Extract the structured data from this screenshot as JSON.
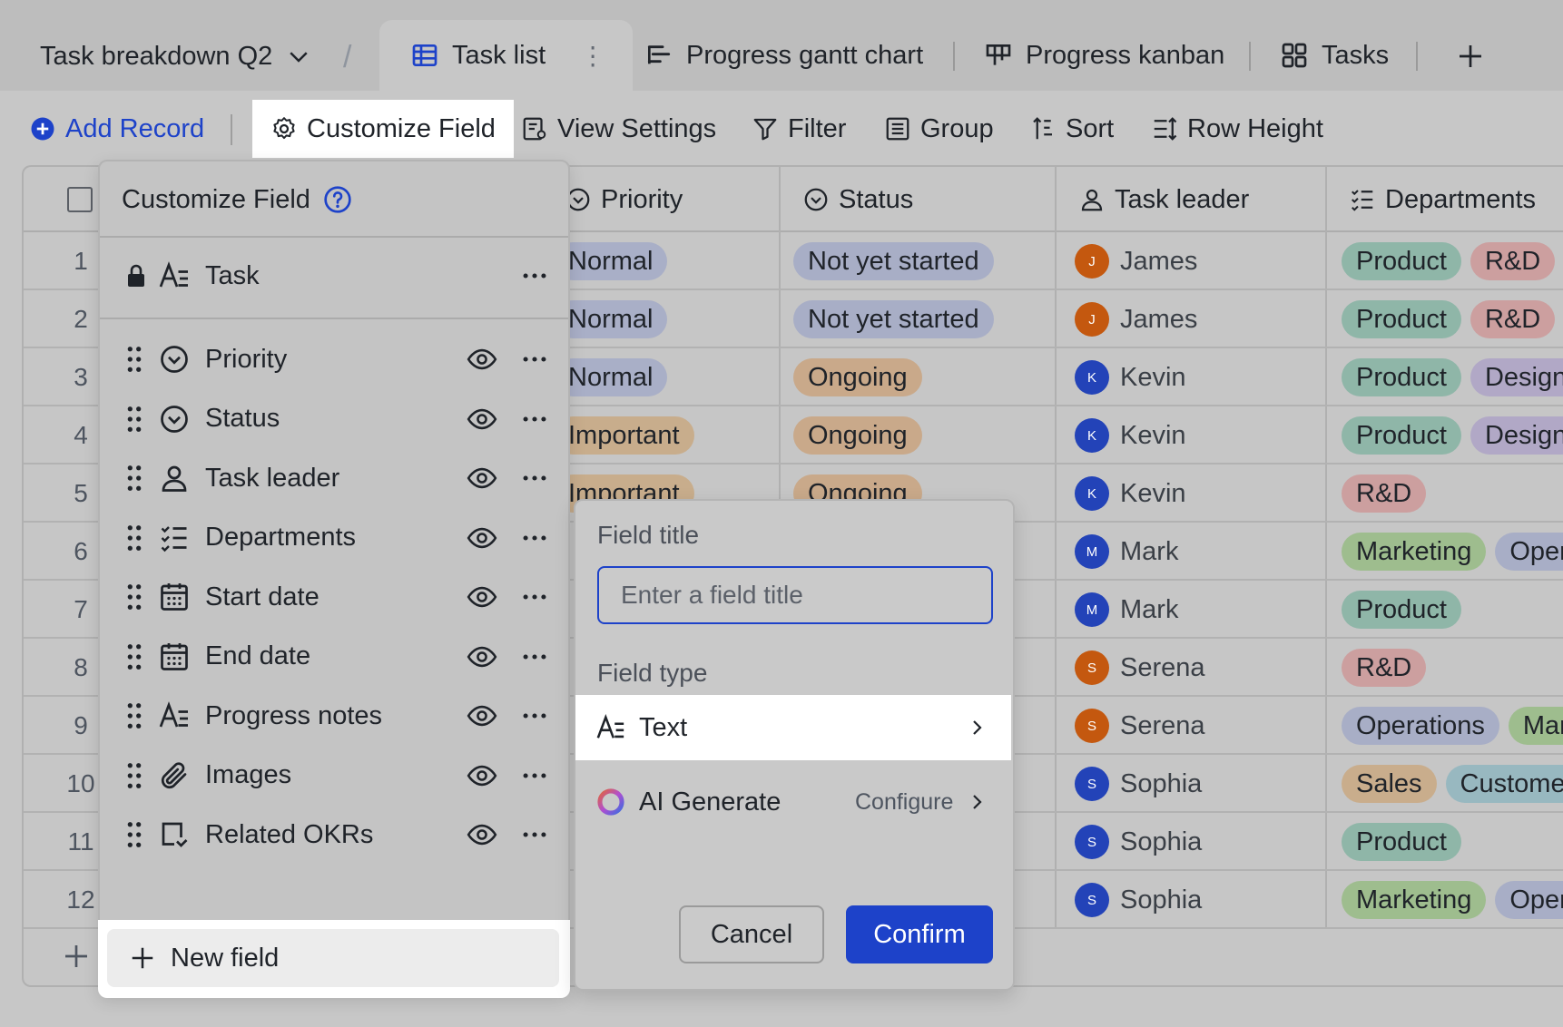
{
  "base_title": "Task breakdown Q2",
  "tabs": [
    {
      "label": "Task list",
      "icon": "grid-table-icon"
    },
    {
      "label": "Progress gantt chart",
      "icon": "gantt-icon"
    },
    {
      "label": "Progress kanban",
      "icon": "kanban-icon"
    },
    {
      "label": "Tasks",
      "icon": "gallery-icon"
    }
  ],
  "toolbar": {
    "add_record": "Add Record",
    "customize_field": "Customize Field",
    "view_settings": "View Settings",
    "filter": "Filter",
    "group": "Group",
    "sort": "Sort",
    "row_height": "Row Height"
  },
  "columns": {
    "priority": "Priority",
    "status": "Status",
    "task_leader": "Task leader",
    "departments": "Departments"
  },
  "rows": [
    {
      "num": "1",
      "priority": "Normal",
      "status": "Not yet started",
      "leader": "James",
      "initial": "J",
      "depts": [
        "Product",
        "R&D"
      ]
    },
    {
      "num": "2",
      "priority": "Normal",
      "status": "Not yet started",
      "leader": "James",
      "initial": "J",
      "depts": [
        "Product",
        "R&D"
      ]
    },
    {
      "num": "3",
      "priority": "Normal",
      "status": "Ongoing",
      "leader": "Kevin",
      "initial": "K",
      "depts": [
        "Product",
        "Design"
      ]
    },
    {
      "num": "4",
      "priority": "Important",
      "status": "Ongoing",
      "leader": "Kevin",
      "initial": "K",
      "depts": [
        "Product",
        "Design"
      ]
    },
    {
      "num": "5",
      "priority": "Important",
      "status": "Ongoing",
      "leader": "Kevin",
      "initial": "K",
      "depts": [
        "R&D"
      ]
    },
    {
      "num": "6",
      "priority": "",
      "status": "",
      "leader": "Mark",
      "initial": "M",
      "depts": [
        "Marketing",
        "Operations"
      ]
    },
    {
      "num": "7",
      "priority": "",
      "status": "",
      "leader": "Mark",
      "initial": "M",
      "depts": [
        "Product"
      ]
    },
    {
      "num": "8",
      "priority": "",
      "status": "",
      "leader": "Serena",
      "initial": "S",
      "depts": [
        "R&D"
      ]
    },
    {
      "num": "9",
      "priority": "",
      "status": "",
      "leader": "Serena",
      "initial": "S",
      "depts": [
        "Operations",
        "Marketing"
      ]
    },
    {
      "num": "10",
      "priority": "",
      "status": "",
      "leader": "Sophia",
      "initial": "S",
      "depts": [
        "Sales",
        "Customer"
      ]
    },
    {
      "num": "11",
      "priority": "",
      "status": "",
      "leader": "Sophia",
      "initial": "S",
      "depts": [
        "Product"
      ]
    },
    {
      "num": "12",
      "priority": "",
      "status": "",
      "leader": "Sophia",
      "initial": "S",
      "depts": [
        "Marketing",
        "Operations"
      ]
    }
  ],
  "customize_panel": {
    "title": "Customize Field",
    "primary_field": "Task",
    "fields": [
      {
        "label": "Priority",
        "icon": "single-select-icon"
      },
      {
        "label": "Status",
        "icon": "single-select-icon"
      },
      {
        "label": "Task leader",
        "icon": "person-icon"
      },
      {
        "label": "Departments",
        "icon": "multi-select-icon"
      },
      {
        "label": "Start date",
        "icon": "calendar-icon"
      },
      {
        "label": "End date",
        "icon": "calendar-icon"
      },
      {
        "label": "Progress notes",
        "icon": "text-icon"
      },
      {
        "label": "Images",
        "icon": "attachment-icon"
      },
      {
        "label": "Related OKRs",
        "icon": "link-record-icon"
      }
    ],
    "new_field": "New field"
  },
  "field_dialog": {
    "title_label": "Field title",
    "title_placeholder": "Enter a field title",
    "type_label": "Field type",
    "type_selected": "Text",
    "ai_generate": "AI Generate",
    "configure": "Configure",
    "cancel": "Cancel",
    "confirm": "Confirm"
  },
  "colors": {
    "accent": "#1d42c9",
    "normal_tag": "#a9afc7",
    "important_tag": "#c8ad8c",
    "not_started_tag": "#a8aec6",
    "ongoing_tag": "#c9a98a",
    "product_tag": "#8fb6a8",
    "rd_tag": "#cc9f9f",
    "design_tag": "#b1a8c6",
    "marketing_tag": "#9ebd8e",
    "operations_tag": "#a8aec6",
    "sales_tag": "#c9ad8c",
    "customer_tag": "#98b8c0",
    "avatar_orange": "#c4580f",
    "avatar_blue": "#2343b8"
  }
}
